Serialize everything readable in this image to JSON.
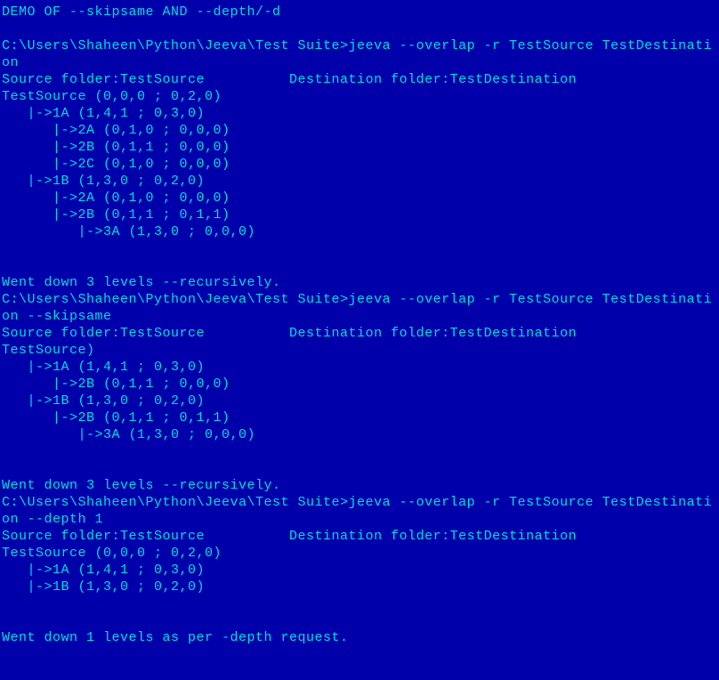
{
  "terminal": {
    "title": "DEMO OF --skipsame AND --depth/-d",
    "section1": {
      "prompt": "C:\\Users\\Shaheen\\Python\\Jeeva\\Test Suite>jeeva --overlap -r TestSource TestDestination",
      "sourceFolder": "Source folder:TestSource          Destination folder:TestDestination",
      "tree": "TestSource (0,0,0 ; 0,2,0)\n   |->1A (1,4,1 ; 0,3,0)\n      |->2A (0,1,0 ; 0,0,0)\n      |->2B (0,1,1 ; 0,0,0)\n      |->2C (0,1,0 ; 0,0,0)\n   |->1B (1,3,0 ; 0,2,0)\n      |->2A (0,1,0 ; 0,0,0)\n      |->2B (0,1,1 ; 0,1,1)\n         |->3A (1,3,0 ; 0,0,0)",
      "footer": "Went down 3 levels --recursively."
    },
    "section2": {
      "prompt": "C:\\Users\\Shaheen\\Python\\Jeeva\\Test Suite>jeeva --overlap -r TestSource TestDestination --skipsame",
      "sourceFolder": "Source folder:TestSource          Destination folder:TestDestination",
      "tree": "TestSource)\n   |->1A (1,4,1 ; 0,3,0)\n      |->2B (0,1,1 ; 0,0,0)\n   |->1B (1,3,0 ; 0,2,0)\n      |->2B (0,1,1 ; 0,1,1)\n         |->3A (1,3,0 ; 0,0,0)",
      "footer": "Went down 3 levels --recursively."
    },
    "section3": {
      "prompt": "C:\\Users\\Shaheen\\Python\\Jeeva\\Test Suite>jeeva --overlap -r TestSource TestDestination --depth 1",
      "sourceFolder": "Source folder:TestSource          Destination folder:TestDestination",
      "tree": "TestSource (0,0,0 ; 0,2,0)\n   |->1A (1,4,1 ; 0,3,0)\n   |->1B (1,3,0 ; 0,2,0)",
      "footer": "Went down 1 levels as per -depth request."
    }
  }
}
